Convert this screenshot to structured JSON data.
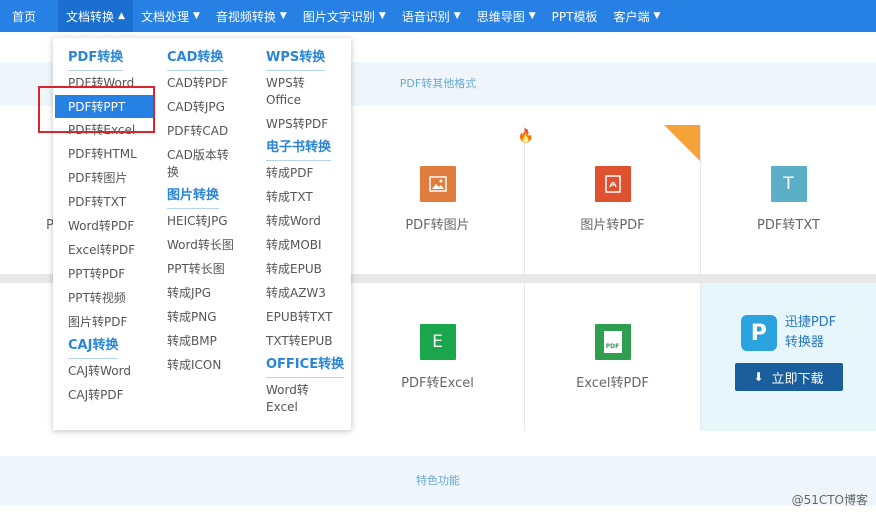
{
  "nav": {
    "items": [
      {
        "label": "首页",
        "caret": false
      },
      {
        "label": "文档转换",
        "caret": "up"
      },
      {
        "label": "文档处理",
        "caret": "down"
      },
      {
        "label": "音视频转换",
        "caret": "down"
      },
      {
        "label": "图片文字识别",
        "caret": "down"
      },
      {
        "label": "语音识别",
        "caret": "down"
      },
      {
        "label": "思维导图",
        "caret": "down"
      },
      {
        "label": "PPT模板",
        "caret": false
      },
      {
        "label": "客户端",
        "caret": "down"
      }
    ]
  },
  "sections": {
    "other_formats": "PDF转其他格式",
    "features": "特色功能"
  },
  "cards": {
    "row1_left_partial": "P",
    "pdf_to_image": "PDF转图片",
    "image_to_pdf": "图片转PDF",
    "pdf_to_txt": "PDF转TXT",
    "pdf_to_excel": "PDF转Excel",
    "excel_to_pdf": "Excel转PDF",
    "txt_icon_letter": "T",
    "excel_icon_letter": "E",
    "excel_pdf_icon_text": "PDF"
  },
  "promo": {
    "logo_letter": "P",
    "line1": "迅捷PDF",
    "line2": "转换器",
    "download": "立即下载"
  },
  "watermark": "@51CTO博客",
  "dropdown": {
    "col1": {
      "head1": "PDF转换",
      "items1": [
        "PDF转Word",
        "PDF转PPT",
        "PDF转Excel",
        "PDF转HTML",
        "PDF转图片",
        "PDF转TXT",
        "Word转PDF",
        "Excel转PDF",
        "PPT转PDF",
        "PPT转视频",
        "图片转PDF"
      ],
      "head2": "CAJ转换",
      "items2": [
        "CAJ转Word",
        "CAJ转PDF"
      ]
    },
    "col2": {
      "head1": "CAD转换",
      "items1": [
        "CAD转PDF",
        "CAD转JPG",
        "PDF转CAD",
        "CAD版本转换"
      ],
      "head2": "图片转换",
      "items2": [
        "HEIC转JPG",
        "Word转长图",
        "PPT转长图",
        "转成JPG",
        "转成PNG",
        "转成BMP",
        "转成ICON"
      ]
    },
    "col3": {
      "head1": "WPS转换",
      "items1": [
        "WPS转Office",
        "WPS转PDF"
      ],
      "head2": "电子书转换",
      "items2": [
        "转成PDF",
        "转成TXT",
        "转成Word",
        "转成MOBI",
        "转成EPUB",
        "转成AZW3",
        "EPUB转TXT",
        "TXT转EPUB"
      ],
      "head3": "OFFICE转换",
      "items3": [
        "Word转Excel"
      ]
    }
  },
  "colors": {
    "nav_bg": "#2780e3",
    "accent": "#2a85d9",
    "highlight_border": "#d9262c",
    "hot_badge": "#f6a23a"
  }
}
